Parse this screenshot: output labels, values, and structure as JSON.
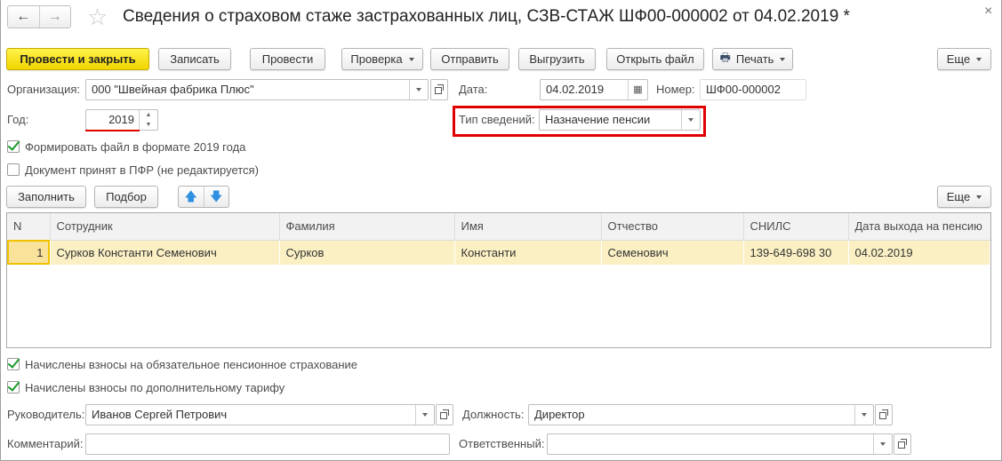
{
  "window": {
    "title": "Сведения о страховом стаже застрахованных лиц, СЗВ-СТАЖ ШФ00-000002 от 04.02.2019 *"
  },
  "toolbar": {
    "post_close": "Провести и закрыть",
    "save": "Записать",
    "post": "Провести",
    "check": "Проверка",
    "send": "Отправить",
    "export": "Выгрузить",
    "open_file": "Открыть файл",
    "print": "Печать",
    "more": "Еще"
  },
  "form": {
    "org_label": "Организация:",
    "org_value": "000 \"Швейная фабрика Плюс\"",
    "date_label": "Дата:",
    "date_value": "04.02.2019",
    "number_label": "Номер:",
    "number_value": "ШФ00-000002",
    "year_label": "Год:",
    "year_value": "2019",
    "type_label": "Тип сведений:",
    "type_value": "Назначение пенсии",
    "cb_format": "Формировать файл в формате 2019 года",
    "cb_accepted": "Документ принят в ПФР (не редактируется)"
  },
  "table_toolbar": {
    "fill": "Заполнить",
    "select": "Подбор",
    "more": "Еще"
  },
  "table": {
    "columns": [
      "N",
      "Сотрудник",
      "Фамилия",
      "Имя",
      "Отчество",
      "СНИЛС",
      "Дата выхода на пенсию"
    ],
    "rows": [
      [
        "1",
        "Сурков Константи Семенович",
        "Сурков",
        "Константи",
        "Семенович",
        "139-649-698 30",
        "04.02.2019"
      ]
    ]
  },
  "footer": {
    "cb_mandatory": "Начислены взносы на обязательное пенсионное страхование",
    "cb_additional": "Начислены взносы по дополнительному тарифу",
    "head_label": "Руководитель:",
    "head_value": "Иванов Сергей Петрович",
    "position_label": "Должность:",
    "position_value": "Директор",
    "comment_label": "Комментарий:",
    "comment_value": "",
    "responsible_label": "Ответственный:",
    "responsible_value": ""
  },
  "colors": {
    "accent": "#f2d600",
    "highlight": "#e00000",
    "row": "#fbf0c4"
  }
}
